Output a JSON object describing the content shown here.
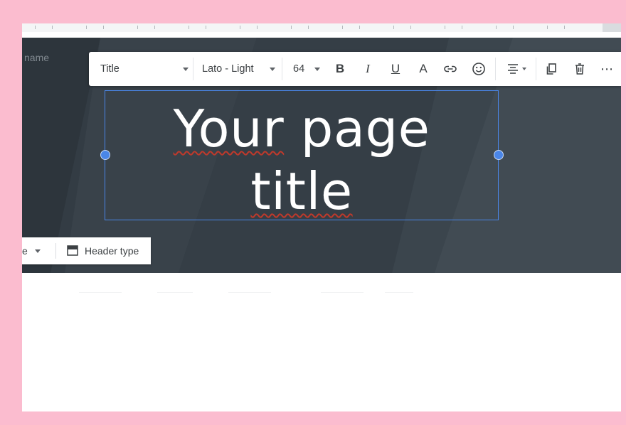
{
  "header": {
    "site_name_fragment": "name",
    "page_title": "Your page title",
    "title_line1_a": "Your",
    "title_line1_b": " page",
    "title_line2": "title"
  },
  "toolbar": {
    "text_style": "Title",
    "font": "Lato - Light",
    "font_size": "64",
    "bold_label": "B",
    "italic_label": "I",
    "underline_label": "U",
    "text_color_label": "A",
    "more_label": "⋯",
    "icons": [
      "bold-icon",
      "italic-icon",
      "underline-icon",
      "text-color-icon",
      "link-icon",
      "emoji-icon",
      "align-center-icon",
      "duplicate-icon",
      "delete-icon",
      "more-icon"
    ]
  },
  "header_toolbar": {
    "theme_fragment": "e",
    "header_type_label": "Header type"
  },
  "colors": {
    "page_background": "#fbbccf",
    "header_background": "#333c44",
    "selection": "#4a86e8",
    "spell_underline": "#c0392b"
  }
}
